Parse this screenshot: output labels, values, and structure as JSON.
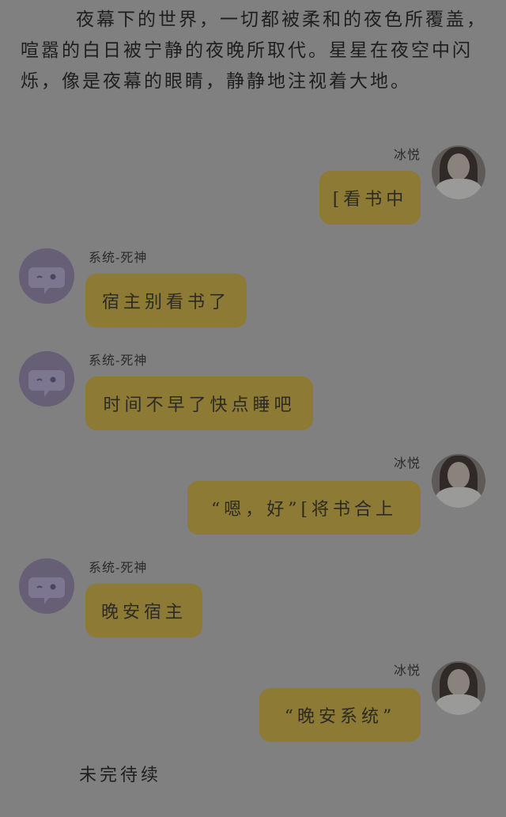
{
  "intro_text": "夜幕下的世界，一切都被柔和的夜色所覆盖，喧嚣的白日被宁静的夜晚所取代。星星在夜空中闪烁，像是夜幕的眼睛，静静地注视着大地。",
  "chat": {
    "user_name": "冰悦",
    "bot_name": "系统-死神",
    "messages": [
      {
        "sender": "user",
        "text": "[看书中"
      },
      {
        "sender": "bot",
        "text": "宿主别看书了"
      },
      {
        "sender": "bot",
        "text": "时间不早了快点睡吧"
      },
      {
        "sender": "user",
        "text": "“嗯，好”[将书合上"
      },
      {
        "sender": "bot",
        "text": "晚安宿主"
      },
      {
        "sender": "user",
        "text": "“晚安系统”"
      }
    ]
  },
  "ending_text": "未完待续",
  "icons": {
    "user_avatar": "girl-portrait-avatar",
    "bot_avatar": "chat-bubble-face-icon"
  },
  "colors": {
    "background": "#808080",
    "bubble": "#8d7a35",
    "bot_avatar": "#665f75"
  }
}
